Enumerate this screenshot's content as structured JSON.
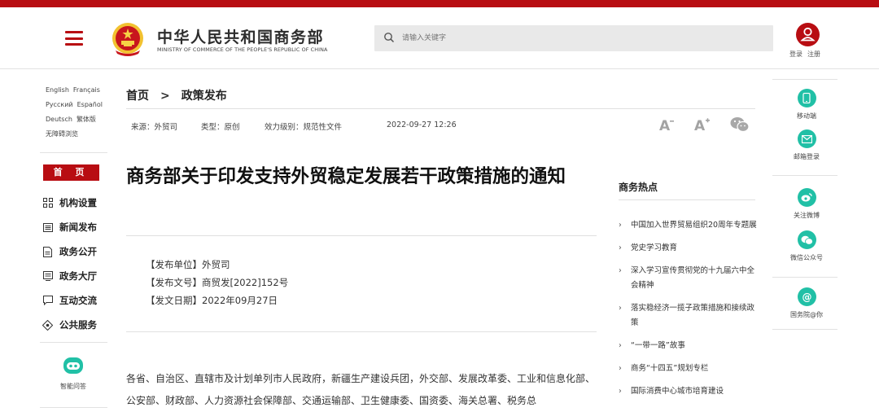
{
  "header": {
    "logo_cn": "中华人民共和国商务部",
    "logo_en": "MINISTRY OF COMMERCE OF THE PEOPLE'S REPUBLIC OF CHINA",
    "search_placeholder": "请输入关键字",
    "login": "登录",
    "register": "注册"
  },
  "languages": [
    "English",
    "Français",
    "Pусский",
    "Español",
    "Deutsch",
    "繁体版",
    "无障碍浏览"
  ],
  "left_nav": {
    "home": "首 页",
    "items": [
      {
        "label": "机构设置",
        "icon": "org-chart-icon"
      },
      {
        "label": "新闻发布",
        "icon": "newspaper-icon"
      },
      {
        "label": "政务公开",
        "icon": "document-icon"
      },
      {
        "label": "政务大厅",
        "icon": "service-hall-icon"
      },
      {
        "label": "互动交流",
        "icon": "chat-icon"
      },
      {
        "label": "公共服务",
        "icon": "public-service-icon"
      }
    ],
    "qa_label": "智能问答"
  },
  "breadcrumb": {
    "home": "首页",
    "separator": ">",
    "current": "政策发布"
  },
  "meta": {
    "source": "来源：外贸司",
    "type": "类型：原创",
    "level": "效力级别：规范性文件",
    "date": "2022-09-27 12:26"
  },
  "article": {
    "title": "商务部关于印发支持外贸稳定发展若干政策措施的通知",
    "publisher": "【发布单位】外贸司",
    "doc_number": "【发布文号】商贸发[2022]152号",
    "publish_date": "【发文日期】2022年09月27日",
    "body": "各省、自治区、直辖市及计划单列市人民政府，新疆生产建设兵团，外交部、发展改革委、工业和信息化部、公安部、财政部、人力资源社会保障部、交通运输部、卫生健康委、国资委、海关总署、税务总"
  },
  "hot": {
    "title": "商务热点",
    "items": [
      "中国加入世界贸易组织20周年专题展",
      "党史学习教育",
      "深入学习宣传贯彻党的十九届六中全会精神",
      "落实稳经济一揽子政策措施和接续政策",
      "“一带一路”故事",
      "商务“十四五”规划专栏",
      "国际消费中心城市培育建设"
    ]
  },
  "right_sidebar": {
    "items": [
      {
        "label": "移动端",
        "icon": "mobile-icon"
      },
      {
        "label": "邮箱登录",
        "icon": "mail-icon"
      },
      {
        "label": "关注微博",
        "icon": "weibo-icon"
      },
      {
        "label": "微信公众号",
        "icon": "wechat-icon"
      },
      {
        "label": "国务院@你",
        "icon": "at-icon"
      }
    ]
  },
  "colors": {
    "brand_red": "#b80d12",
    "accent_teal": "#21c0a6"
  }
}
